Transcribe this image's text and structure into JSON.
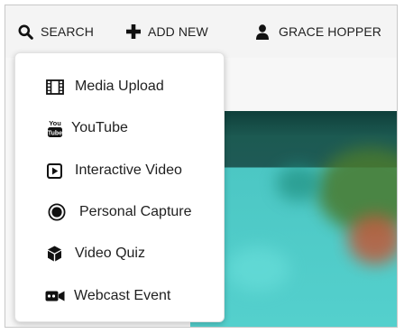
{
  "topbar": {
    "search_label": "SEARCH",
    "add_new_label": "ADD NEW",
    "user_name": "GRACE HOPPER"
  },
  "dropdown": {
    "items": [
      {
        "label": "Media Upload",
        "icon": "film-icon"
      },
      {
        "label": "YouTube",
        "icon": "youtube-icon"
      },
      {
        "label": "Interactive Video",
        "icon": "play-square-icon"
      },
      {
        "label": "Personal Capture",
        "icon": "record-icon"
      },
      {
        "label": "Video Quiz",
        "icon": "cube-icon"
      },
      {
        "label": "Webcast Event",
        "icon": "video-camera-icon"
      }
    ]
  },
  "youtube_logo_text": {
    "top": "You",
    "bottom": "Tube"
  },
  "colors": {
    "accent_teal": "#54d0cd",
    "dark_teal": "#1c5a52",
    "text": "#1f1f1f"
  }
}
